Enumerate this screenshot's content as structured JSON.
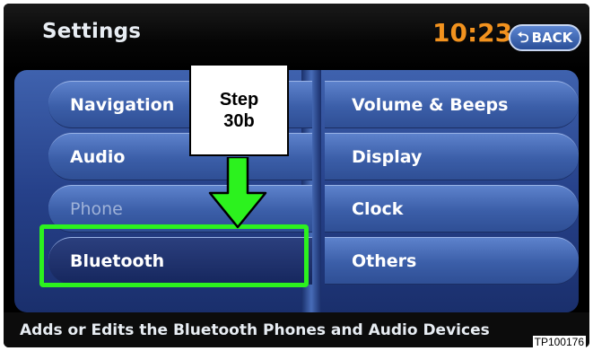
{
  "header": {
    "title": "Settings",
    "time": "10:23",
    "back_label": "BACK"
  },
  "menu": {
    "left": [
      {
        "label": "Navigation",
        "state": "normal"
      },
      {
        "label": "Audio",
        "state": "normal"
      },
      {
        "label": "Phone",
        "state": "disabled"
      },
      {
        "label": "Bluetooth",
        "state": "selected"
      }
    ],
    "right": [
      {
        "label": "Volume & Beeps"
      },
      {
        "label": "Display"
      },
      {
        "label": "Clock"
      },
      {
        "label": "Others"
      }
    ]
  },
  "footer": {
    "hint": "Adds or Edits the Bluetooth Phones and Audio Devices"
  },
  "annotation": {
    "line1": "Step",
    "line2": "30b",
    "reference": "TP100176",
    "highlight_color": "#2cf21e"
  },
  "colors": {
    "accent": "#f2921e",
    "button_blue": "#3b5ea8"
  }
}
